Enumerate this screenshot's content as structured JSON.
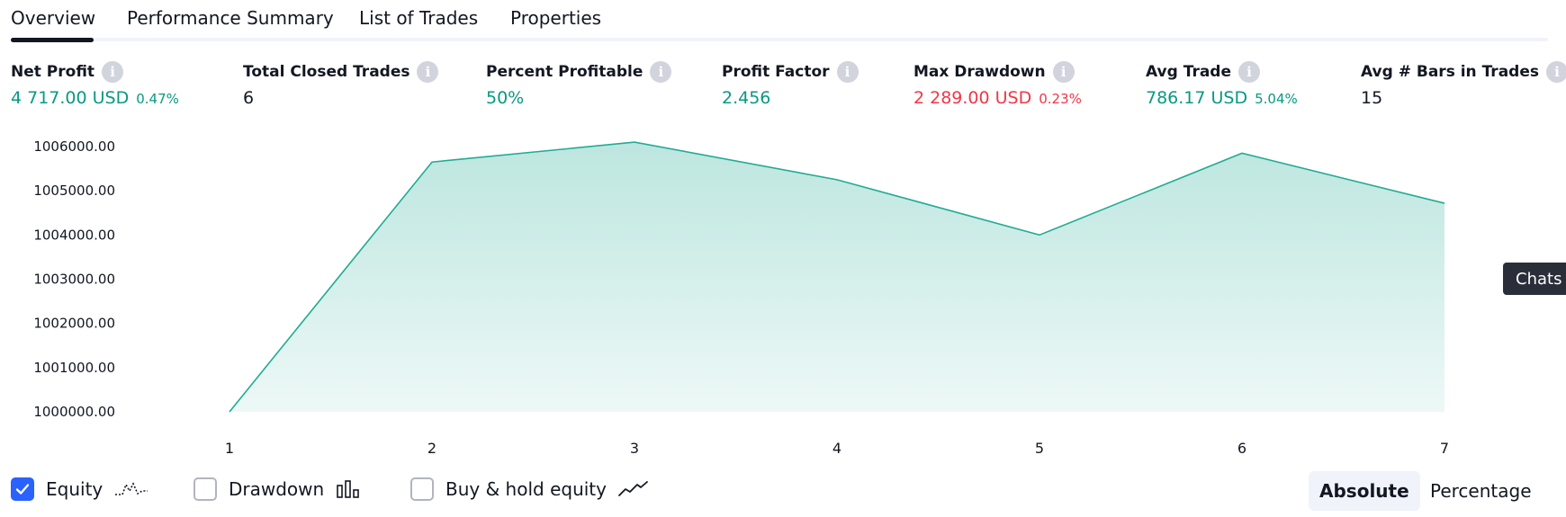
{
  "tabs": [
    {
      "label": "Overview",
      "active": true
    },
    {
      "label": "Performance Summary"
    },
    {
      "label": "List of Trades"
    },
    {
      "label": "Properties"
    }
  ],
  "stats": [
    {
      "title": "Net Profit",
      "value": "4 717.00 USD",
      "sub": "0.47%",
      "color": "green"
    },
    {
      "title": "Total Closed Trades",
      "value": "6",
      "sub": "",
      "color": "dark"
    },
    {
      "title": "Percent Profitable",
      "value": "50%",
      "sub": "",
      "color": "green"
    },
    {
      "title": "Profit Factor",
      "value": "2.456",
      "sub": "",
      "color": "green"
    },
    {
      "title": "Max Drawdown",
      "value": "2 289.00 USD",
      "sub": "0.23%",
      "color": "red"
    },
    {
      "title": "Avg Trade",
      "value": "786.17 USD",
      "sub": "5.04%",
      "color": "green"
    },
    {
      "title": "Avg # Bars in Trades",
      "value": "15",
      "sub": "",
      "color": "dark"
    }
  ],
  "info_icon": "i",
  "chart_data": {
    "type": "area",
    "x": [
      1,
      2,
      3,
      4,
      5,
      6,
      7
    ],
    "series": [
      {
        "values": [
          1000000,
          1005650,
          1006100,
          1005250,
          1004000,
          1005850,
          1004717
        ]
      }
    ],
    "ytick_labels": [
      "1006000.00",
      "1005000.00",
      "1004000.00",
      "1003000.00",
      "1002000.00",
      "1001000.00",
      "1000000.00"
    ],
    "ylim": [
      1000000,
      1006000
    ],
    "xlabel": "",
    "ylabel": "",
    "line_color": "#22ab94",
    "fill_color": "#b2e0d4"
  },
  "chats_label": "Chats",
  "legend": [
    {
      "label": "Equity",
      "checked": true,
      "icon": "equity-icon"
    },
    {
      "label": "Drawdown",
      "checked": false,
      "icon": "drawdown-bars-icon"
    },
    {
      "label": "Buy & hold equity",
      "checked": false,
      "icon": "buy-hold-line-icon"
    }
  ],
  "view_mode": {
    "absolute": "Absolute",
    "percentage": "Percentage",
    "active": "Absolute"
  }
}
